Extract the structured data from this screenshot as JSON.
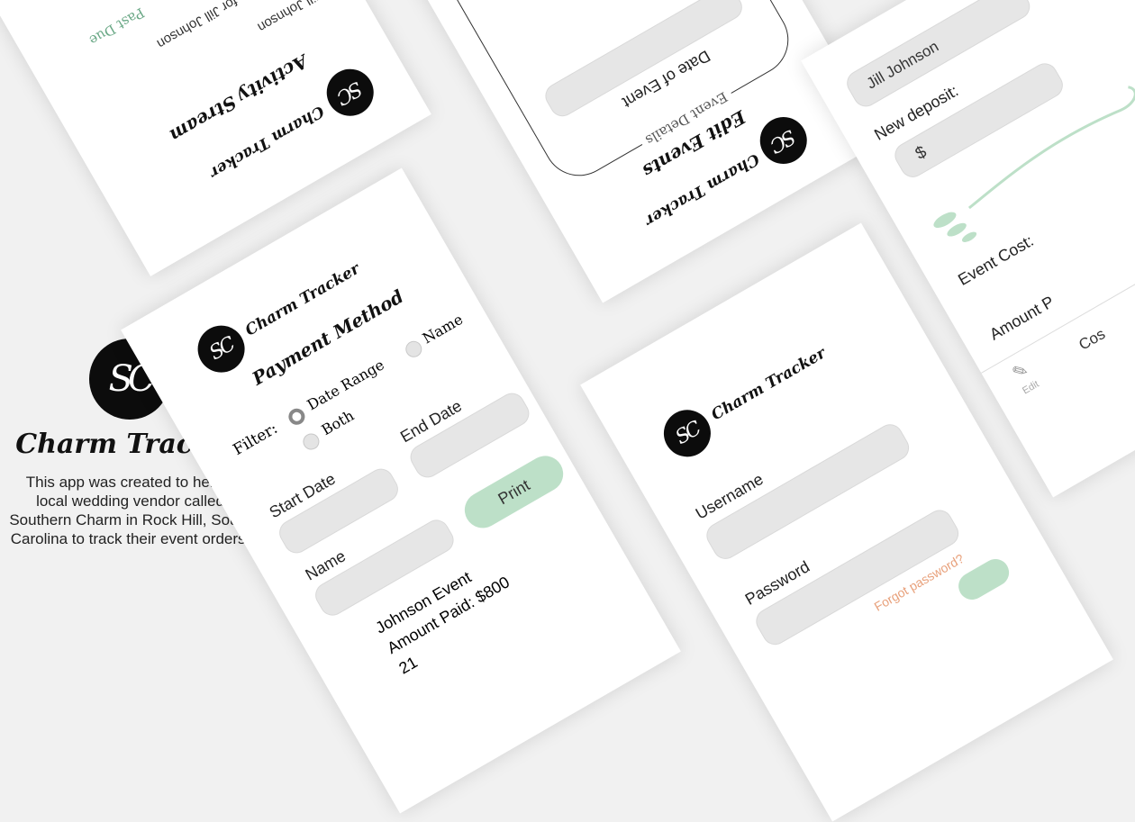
{
  "intro": {
    "logo_text": "SC",
    "title": "Charm Tracker",
    "description": "This app was created to help a local wedding vendor called Southern Charm in Rock Hill, South Carolina to track their event orders."
  },
  "activity_card": {
    "brand": "Charm Tracker",
    "logo_text": "SC",
    "heading": "Activity Stream",
    "line1": "Deposit due for Jill Johnson",
    "line2": "Jill Johnson",
    "status": "Past Due"
  },
  "payment_card": {
    "brand": "Charm Tracker",
    "logo_text": "SC",
    "heading": "Payment Method",
    "filter_label": "Filter:",
    "options": [
      "Date Range",
      "Name",
      "Both"
    ],
    "start_date_label": "Start Date",
    "end_date_label": "End Date",
    "name_label": "Name",
    "print_label": "Print",
    "event_title": "Johnson Event",
    "amount_paid": "Amount Paid: $800",
    "date_fragment": "21"
  },
  "edit_card": {
    "brand": "Charm Tracker",
    "logo_text": "SC",
    "heading": "Edit Events",
    "section": "Event Details",
    "field_label": "Date of Event"
  },
  "login_card": {
    "brand": "Charm Tracker",
    "logo_text": "SC",
    "username_label": "Username",
    "password_label": "Password",
    "forgot_label": "Forgot password?"
  },
  "deposit_card": {
    "name_value": "Jill Johnson",
    "new_deposit_label": "New deposit:",
    "currency": "$",
    "event_cost_label": "Event Cost:",
    "amount_label": "Amount P",
    "edit_label": "Edit",
    "cost_fragment": "Cos"
  },
  "colors": {
    "accent_green": "#bde0c8",
    "forgot_orange": "#e8a07a",
    "status_green": "#6aa886"
  }
}
